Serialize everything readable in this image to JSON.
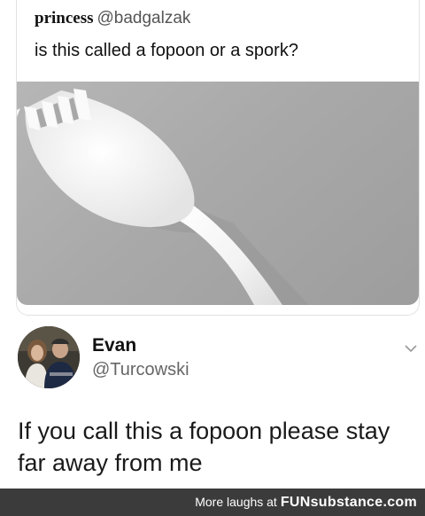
{
  "tweet1": {
    "name": "princess",
    "handle": "@badgalzak",
    "text": "is this called a fopoon or a spork?",
    "image_icon": "spork-photo"
  },
  "tweet2": {
    "name": "Evan",
    "handle": "@Turcowski",
    "text": "If you call this a fopoon please stay far away from me",
    "menu_icon": "chevron-down-icon",
    "avatar_icon": "profile-photo"
  },
  "footer": {
    "text": "More laughs at",
    "brand": "FUNsubstance.com"
  },
  "colors": {
    "footer_bg": "#3b3b3b",
    "photo_bg": "#a9a9a9",
    "handle_gray": "#666666"
  }
}
